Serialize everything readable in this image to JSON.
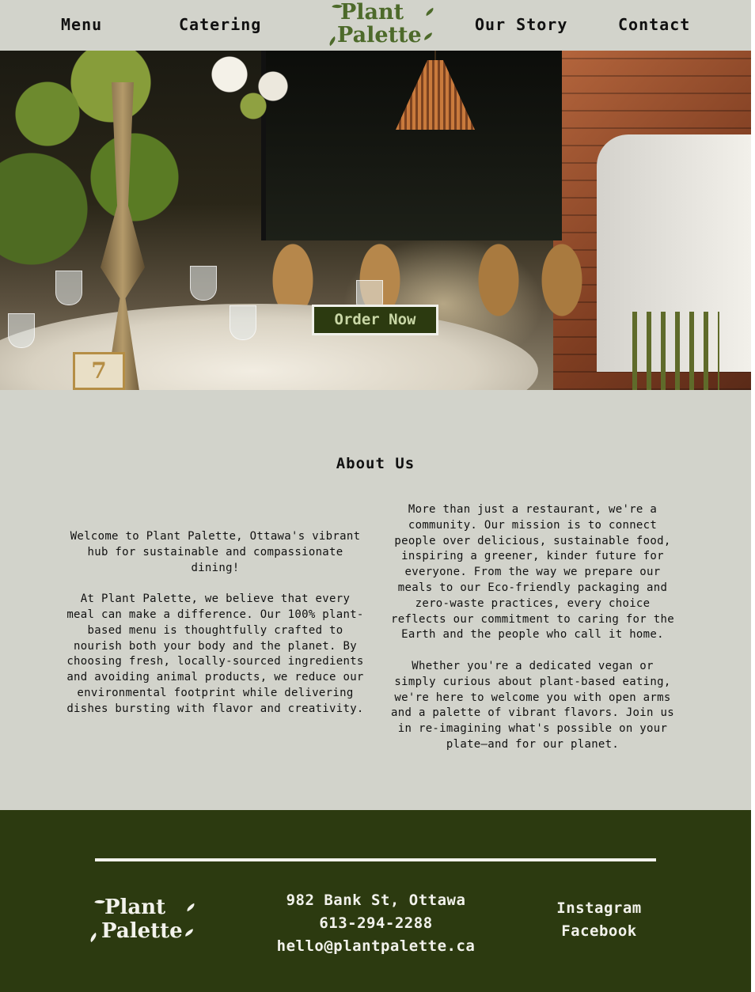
{
  "nav": {
    "links": [
      {
        "label": "Menu"
      },
      {
        "label": "Catering"
      },
      {
        "label": "Our Story"
      },
      {
        "label": "Contact"
      }
    ],
    "logo_line1": "Plant",
    "logo_line2": "Palette"
  },
  "hero": {
    "order_button": "Order Now",
    "table_number": "7"
  },
  "about": {
    "title": "About Us",
    "left": {
      "p1": "Welcome to Plant Palette, Ottawa's vibrant hub for sustainable and compassionate dining!",
      "p2": "At Plant Palette, we believe that every meal can make a difference. Our 100% plant-based menu is thoughtfully crafted to nourish both your body and the planet. By choosing fresh, locally-sourced ingredients and avoiding animal products, we reduce our environmental footprint while delivering dishes bursting with flavor and creativity."
    },
    "right": {
      "p1": "More than just a restaurant, we're a community. Our mission is to connect people over delicious, sustainable food, inspiring a greener, kinder future for everyone. From the way we prepare our meals to our Eco-friendly packaging and zero-waste practices, every choice reflects our commitment to caring for the Earth and the people who call it home.",
      "p2": "Whether you're a dedicated vegan or simply curious about plant-based eating, we're here to welcome you with open arms and a palette of vibrant flavors. Join us in re-imagining what's possible on your plate—and for our planet."
    }
  },
  "footer": {
    "logo_line1": "Plant",
    "logo_line2": "Palette",
    "address": "982 Bank St, Ottawa",
    "phone": "613-294-2288",
    "email": "hello@plantpalette.ca",
    "social": [
      "Instagram",
      "Facebook"
    ]
  },
  "colors": {
    "background": "#d2d3cb",
    "brand_green": "#4d6a2a",
    "footer_green": "#2c3a10",
    "button_text": "#c9d7a6"
  }
}
